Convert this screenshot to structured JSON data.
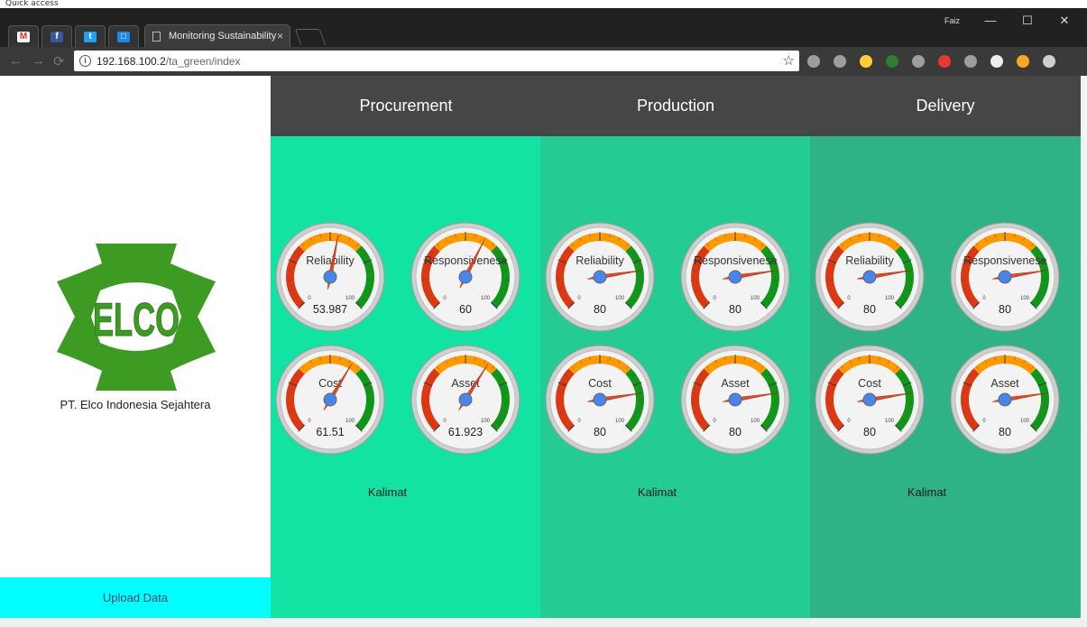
{
  "quick_access": "Quick access",
  "browser": {
    "tab_title": "Monitoring Sustainability",
    "tab_close": "×",
    "mini_tabs": [
      {
        "icon": "gmail-icon",
        "glyph": "M",
        "color": "#d93025"
      },
      {
        "icon": "facebook-icon",
        "glyph": "f",
        "color": "#3b5998"
      },
      {
        "icon": "twitter-icon",
        "glyph": "t",
        "color": "#1da1f2"
      },
      {
        "icon": "chat-icon",
        "glyph": "□",
        "color": "#1e88e5"
      }
    ],
    "user": "Faiz",
    "url_host": "192.168.100.2",
    "url_path": "/ta_green/index",
    "star": "☆",
    "info": "i",
    "back": "←",
    "forward": "→",
    "reload": "⟳",
    "minimize": "—",
    "maximize": "☐",
    "close": "✕",
    "extension_colors": [
      "#9e9e9e",
      "#9e9e9e",
      "#ffcc33",
      "#2e7d32",
      "#9e9e9e",
      "#e53935",
      "#9e9e9e",
      "#eeeeee",
      "#f9a825",
      "#cfcfcf"
    ]
  },
  "sidebar": {
    "logo_text": "ELCO",
    "company": "PT. Elco Indonesia Sejahtera",
    "upload_label": "Upload Data"
  },
  "colors": {
    "procurement_bg": "#13e3a2",
    "production_bg": "#24cc94",
    "delivery_bg": "#2fb386",
    "header_bg": "#464646",
    "upload_bg": "#00ffff",
    "logo_green": "#3d9b23"
  },
  "sections": [
    {
      "name": "Procurement",
      "kalimat": "Kalimat",
      "gauges": [
        {
          "label": "Reliability",
          "value": 53.987,
          "display": "53.987"
        },
        {
          "label": "Responsiveness",
          "value": 60,
          "display": "60"
        },
        {
          "label": "Cost",
          "value": 61.51,
          "display": "61.51"
        },
        {
          "label": "Asset",
          "value": 61.923,
          "display": "61.923"
        }
      ]
    },
    {
      "name": "Production",
      "kalimat": "Kalimat",
      "gauges": [
        {
          "label": "Reliability",
          "value": 80,
          "display": "80"
        },
        {
          "label": "Responsiveness",
          "value": 80,
          "display": "80"
        },
        {
          "label": "Cost",
          "value": 80,
          "display": "80"
        },
        {
          "label": "Asset",
          "value": 80,
          "display": "80"
        }
      ]
    },
    {
      "name": "Delivery",
      "kalimat": "Kalimat",
      "gauges": [
        {
          "label": "Reliability",
          "value": 80,
          "display": "80"
        },
        {
          "label": "Responsiveness",
          "value": 80,
          "display": "80"
        },
        {
          "label": "Cost",
          "value": 80,
          "display": "80"
        },
        {
          "label": "Asset",
          "value": 80,
          "display": "80"
        }
      ]
    }
  ],
  "gauge_scale": {
    "min": 0,
    "max": 100,
    "min_label": "0",
    "max_label": "100"
  }
}
